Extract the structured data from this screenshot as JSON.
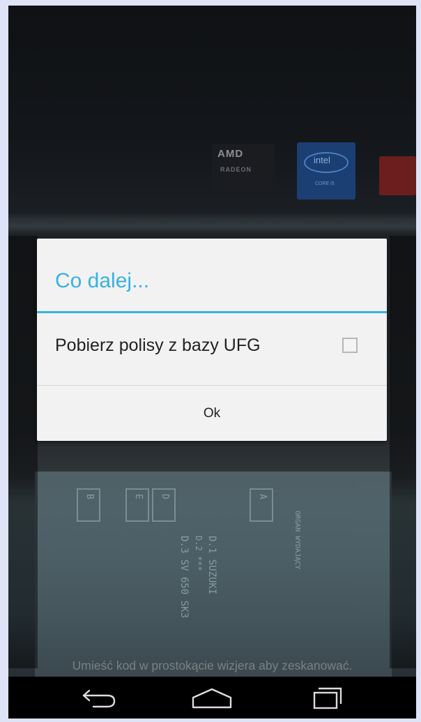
{
  "dialog": {
    "title": "Co dalej...",
    "option_label": "Pobierz polisy z bazy UFG",
    "option_checked": false,
    "ok_label": "Ok"
  },
  "camera": {
    "hint": "Umieść kod w prostokącie wizjera aby zeskanować.",
    "stickers": {
      "amd_brand": "AMD",
      "amd_sub": "RADEON",
      "intel_brand": "intel",
      "intel_sub": "CORE i5"
    },
    "document_lines": [
      "D.1 SUZUKI",
      "D.2 ***",
      "D.3 SV 650 SK3",
      "ORGAN WYDAJĄCY"
    ],
    "document_boxes": [
      "B",
      "E",
      "D",
      "A"
    ]
  },
  "navbar": {
    "back_icon": "back-arrow-icon",
    "home_icon": "home-icon",
    "recent_icon": "recent-apps-icon"
  },
  "colors": {
    "accent": "#33b5e5",
    "dialog_bg": "#f2f2f2",
    "frame_bg": "#dfe3f6"
  }
}
